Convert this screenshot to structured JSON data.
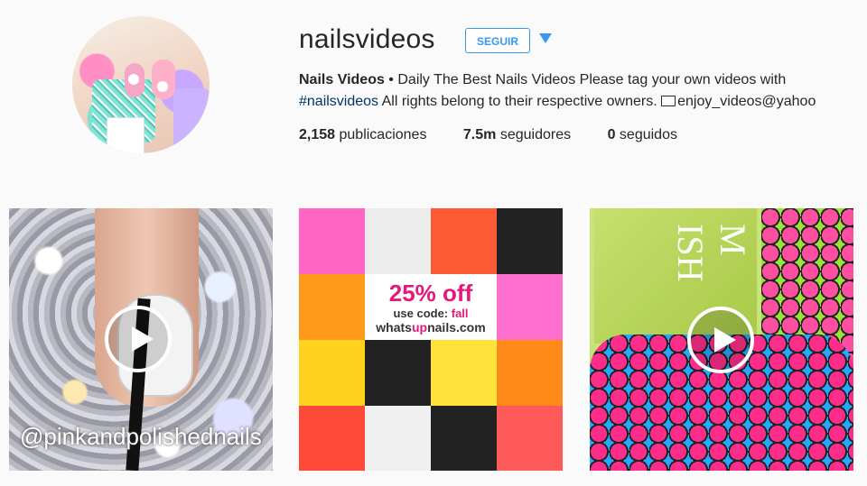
{
  "profile": {
    "username": "nailsvideos",
    "follow_label": "SEGUIR",
    "bio_name": "Nails Videos",
    "bio_sep": " • ",
    "bio_text1": "Daily The Best Nails Videos Please tag your own videos with",
    "bio_hashtag": "#nailsvideos",
    "bio_text2": " All rights belong to their respective owners. ",
    "bio_email": "enjoy_videos@yahoo"
  },
  "stats": [
    {
      "value": "2,158",
      "label": "publicaciones"
    },
    {
      "value": "7.5m",
      "label": "seguidores"
    },
    {
      "value": "0",
      "label": "seguidos"
    }
  ],
  "posts": {
    "post1_watermark": "@pinkandpolishednails",
    "promo_big": "25% off",
    "promo_code_prefix": "use code: ",
    "promo_code": "fall",
    "promo_site_a": "whats",
    "promo_site_b": "up",
    "promo_site_c": "nails.com",
    "post3_bottle_text": "M ISH"
  },
  "colors": {
    "accent": "#3897f0",
    "hashtag": "#003569",
    "promo_pink": "#e5197b"
  }
}
